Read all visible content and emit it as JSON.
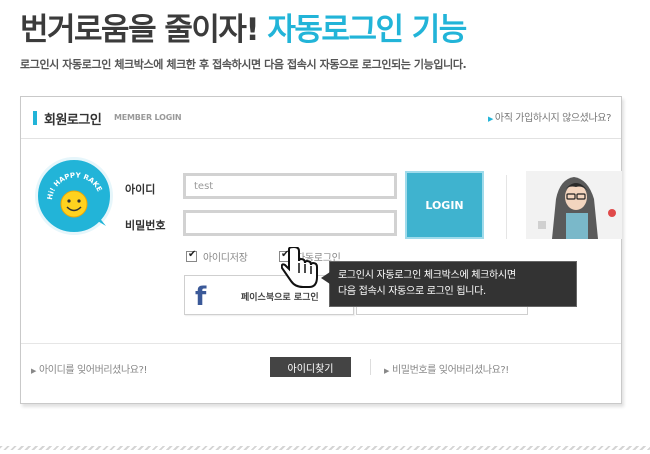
{
  "headline": {
    "part1": "번거로움을 줄이자!",
    "part2": "자동로그인 기능"
  },
  "subtitle": "로그인시 자동로그인 체크박스에 체크한 후 접속하시면 다음 접속시 자동으로 로그인되는 기능입니다.",
  "card": {
    "title": "회원로그인",
    "title_en": "MEMBER LOGIN",
    "join_link": "아직 가입하시지 않으셨나요?"
  },
  "badge": {
    "text": "Hi! HAPPY RAKE"
  },
  "form": {
    "id_label": "아이디",
    "id_value": "test",
    "pw_label": "비밀번호",
    "login_button": "LOGIN",
    "save_id_label": "아이디저장",
    "auto_login_label": "자동로그인"
  },
  "social": {
    "facebook_label": "페이스북으로 로그인"
  },
  "tooltip": {
    "line1": "로그인시 자동로그인 체크박스에 체크하시면",
    "line2": "다음 접속시 자동으로 로그인 됩니다."
  },
  "footer": {
    "forgot_id": "아이디를 잊어버리셨나요?!",
    "find_id_button": "아이디찾기",
    "forgot_pw": "비밀번호를 잊어버리셨나요?!"
  },
  "colors": {
    "accent": "#22b4d8",
    "login_button": "#3fb3cf",
    "tooltip_bg": "#333333",
    "facebook": "#3b5998"
  }
}
